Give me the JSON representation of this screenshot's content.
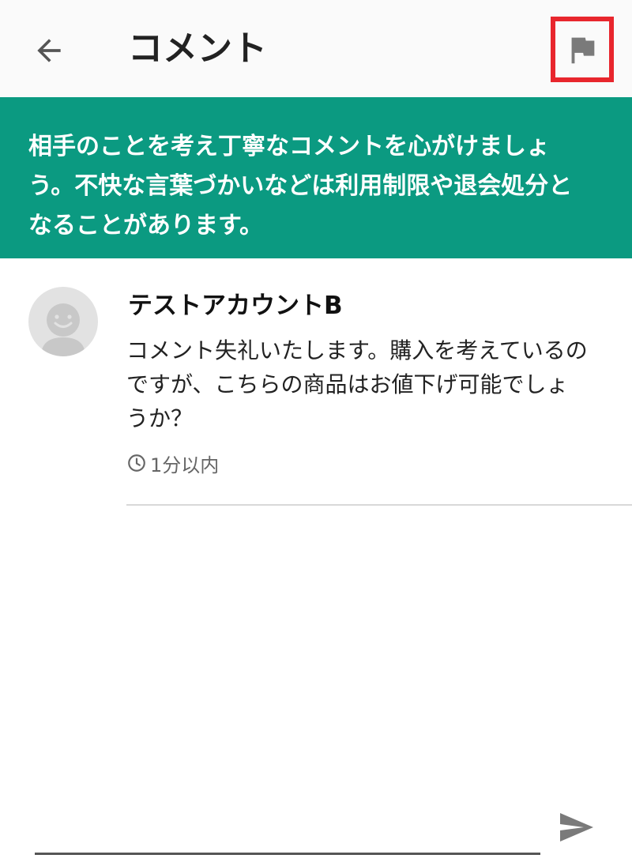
{
  "header": {
    "title": "コメント",
    "back_icon": "arrow-left-icon",
    "report_icon": "flag-icon",
    "highlight_color": "#e8262d"
  },
  "notice": {
    "text": "相手のことを考え丁寧なコメントを心がけましょ\nう。不快な言葉づかいなどは利用制限や退会処分と\nなることがあります。",
    "background_color": "#0b9a81"
  },
  "comments": [
    {
      "author": "テストアカウントB",
      "body": "コメント失礼いたします。購入を考えているの\nですが、こちらの商品はお値下げ可能でしょ\nうか？",
      "time": "1分以内",
      "avatar_icon": "default-avatar-icon"
    }
  ],
  "composer": {
    "placeholder": "",
    "send_icon": "send-icon"
  }
}
